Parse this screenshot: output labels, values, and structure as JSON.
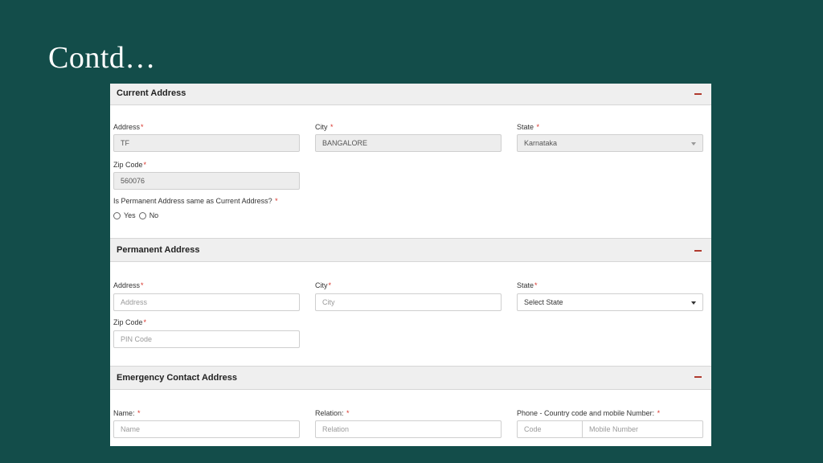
{
  "slide": {
    "title": "Contd…"
  },
  "colors": {
    "background": "#134d4a",
    "required": "#d9332a",
    "collapse": "#b03a2e"
  },
  "current_address": {
    "header": "Current Address",
    "address_label": "Address",
    "address_value": "TF",
    "city_label": "City",
    "city_value": "BANGALORE",
    "state_label": "State",
    "state_value": "Karnataka",
    "zip_label": "Zip Code",
    "zip_value": "560076",
    "same_question": "Is Permanent Address same as Current Address?",
    "yes_label": "Yes",
    "no_label": "No",
    "required_mark": "*"
  },
  "permanent_address": {
    "header": "Permanent Address",
    "address_label": "Address",
    "address_placeholder": "Address",
    "city_label": "City",
    "city_placeholder": "City",
    "state_label": "State",
    "state_value": "Select State",
    "zip_label": "Zip Code",
    "zip_placeholder": "PIN Code",
    "required_mark": "*"
  },
  "emergency_contact": {
    "header": "Emergency Contact Address",
    "name_label": "Name:",
    "name_placeholder": "Name",
    "relation_label": "Relation:",
    "relation_placeholder": "Relation",
    "phone_label": "Phone - Country code and mobile Number:",
    "code_placeholder": "Code",
    "mobile_placeholder": "Mobile Number",
    "required_mark": "*"
  }
}
